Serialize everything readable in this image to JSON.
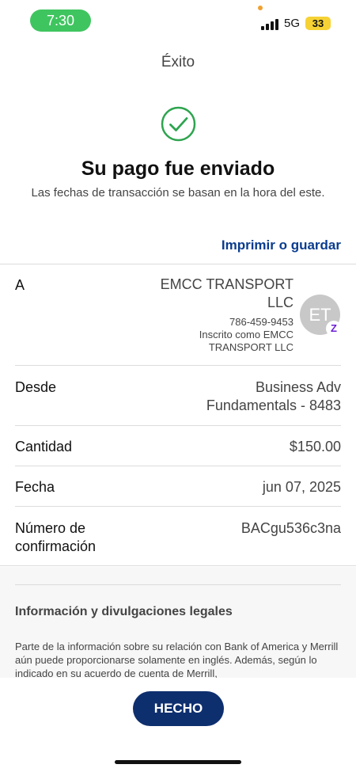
{
  "status_bar": {
    "time": "7:30",
    "network": "5G",
    "battery": "33"
  },
  "screen": {
    "title": "Éxito",
    "icon": "check-circle-icon",
    "heading": "Su pago fue enviado",
    "subheading": "Las fechas de transacción se basan en la hora del este."
  },
  "actions": {
    "print_label": "Imprimir o guardar",
    "done_label": "HECHO"
  },
  "details": {
    "to": {
      "label": "A",
      "name_line1": "EMCC TRANSPORT",
      "name_line2": "LLC",
      "phone": "786-459-9453",
      "enrolled_line1": "Inscrito como EMCC",
      "enrolled_line2": "TRANSPORT LLC",
      "avatar_initials": "ET",
      "badge": "Z"
    },
    "from": {
      "label": "Desde",
      "value_line1": "Business Adv",
      "value_line2": "Fundamentals - 8483"
    },
    "amount": {
      "label": "Cantidad",
      "value": "$150.00"
    },
    "date": {
      "label": "Fecha",
      "value": "jun 07, 2025"
    },
    "confirmation": {
      "label_line1": "Número de",
      "label_line2": "confirmación",
      "value": "BACgu536c3na"
    }
  },
  "legal": {
    "title": "Información y divulgaciones legales",
    "body": "Parte de la información sobre su relación con Bank of America y Merrill aún puede proporcionarse solamente en inglés. Además, según lo indicado en su acuerdo de cuenta de Merrill,"
  },
  "colors": {
    "accent": "#0e2f6e",
    "link": "#0a3c8e",
    "success": "#2ea44f",
    "time_pill": "#3fc55f",
    "zelle": "#6d1ed4"
  }
}
